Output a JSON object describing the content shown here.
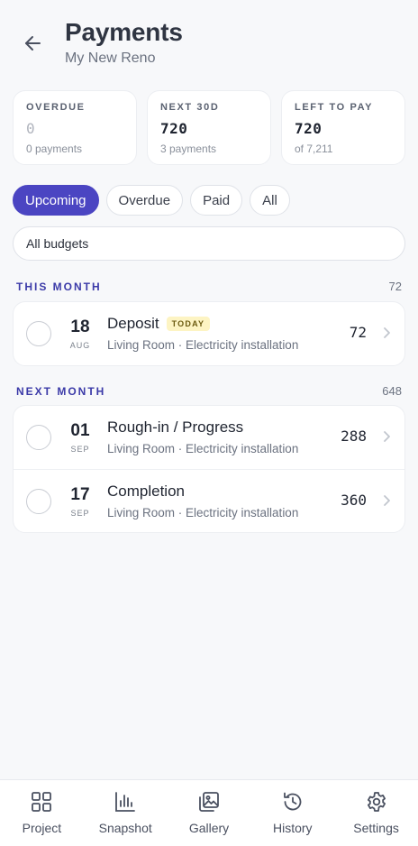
{
  "header": {
    "title": "Payments",
    "subtitle": "My New Reno"
  },
  "stats": [
    {
      "label": "OVERDUE",
      "value": "0",
      "sub": "0 payments"
    },
    {
      "label": "NEXT 30D",
      "value": "720",
      "sub": "3 payments"
    },
    {
      "label": "LEFT TO PAY",
      "value": "720",
      "sub": "of 7,211"
    }
  ],
  "filters": {
    "upcoming": "Upcoming",
    "overdue": "Overdue",
    "paid": "Paid",
    "all": "All",
    "active": "Upcoming"
  },
  "budget_filter": {
    "value": "All budgets"
  },
  "sections": {
    "this_month": {
      "title": "THIS MONTH",
      "total": "72",
      "items": [
        {
          "day": "18",
          "month": "AUG",
          "title": "Deposit",
          "badge": "TODAY",
          "meta": "Living Room · Electricity installation",
          "amount": "72"
        }
      ]
    },
    "next_month": {
      "title": "NEXT MONTH",
      "total": "648",
      "items": [
        {
          "day": "01",
          "month": "SEP",
          "title": "Rough-in / Progress",
          "meta": "Living Room · Electricity installation",
          "amount": "288"
        },
        {
          "day": "17",
          "month": "SEP",
          "title": "Completion",
          "meta": "Living Room · Electricity installation",
          "amount": "360"
        }
      ]
    }
  },
  "tabbar": {
    "project": "Project",
    "snapshot": "Snapshot",
    "gallery": "Gallery",
    "history": "History",
    "settings": "Settings"
  },
  "colors": {
    "accent": "#4b45c2",
    "section_title": "#3b3aa8",
    "today_badge_bg": "#fdf4c3"
  }
}
